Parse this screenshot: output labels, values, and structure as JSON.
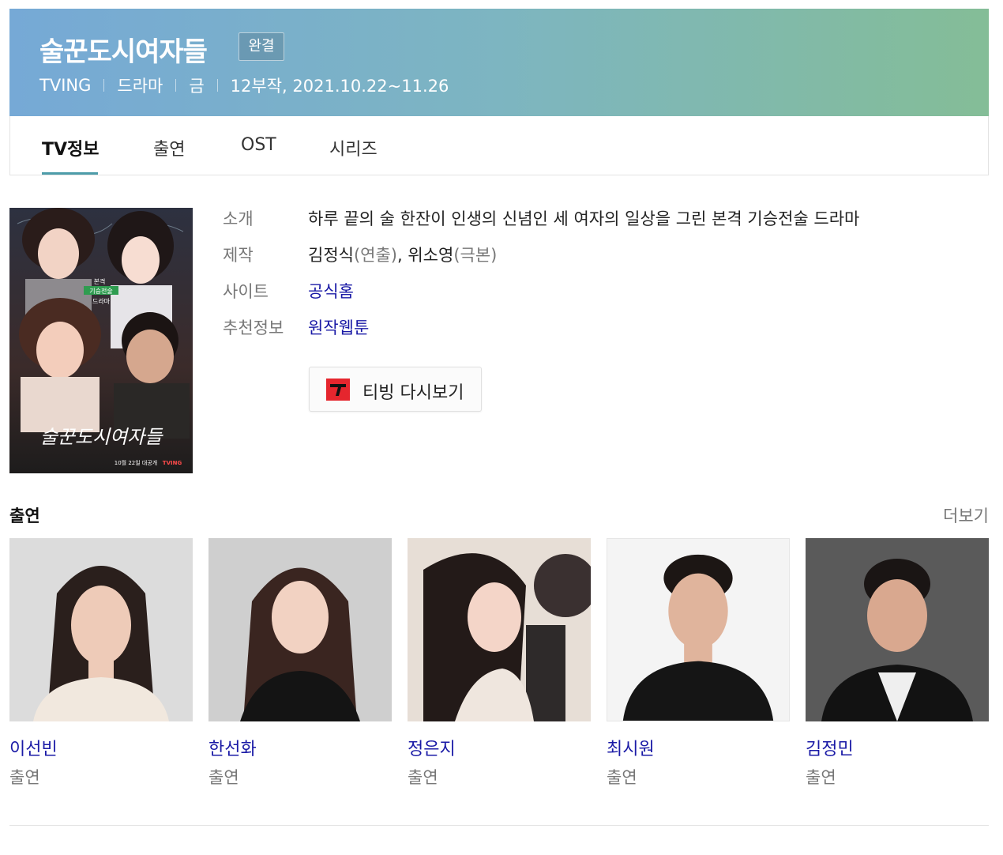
{
  "header": {
    "title": "술꾼도시여자들",
    "badge": "완결",
    "meta": [
      "TVING",
      "드라마",
      "금",
      "12부작, 2021.10.22~11.26"
    ]
  },
  "tabs": [
    {
      "label": "TV정보",
      "active": true
    },
    {
      "label": "출연",
      "active": false
    },
    {
      "label": "OST",
      "active": false
    },
    {
      "label": "시리즈",
      "active": false
    }
  ],
  "poster": {
    "title": "술꾼도시여자들",
    "tagline": [
      "본격",
      "기승전술",
      "드라마"
    ],
    "broadcast": "10월 22일 대공개",
    "brand": "TVING"
  },
  "info": {
    "intro_label": "소개",
    "intro_value": "하루 끝의 술 한잔이 인생의 신념인 세 여자의 일상을 그린 본격 기승전술 드라마",
    "production_label": "제작",
    "director": "김정식",
    "director_role": "(연출)",
    "comma": ", ",
    "writer": "위소영",
    "writer_role": "(극본)",
    "site_label": "사이트",
    "site_value": "공식홈",
    "recommend_label": "추천정보",
    "recommend_value": "원작웹툰"
  },
  "watch_button": {
    "label": "티빙 다시보기",
    "icon": "tving-icon",
    "icon_color": "#e5262e"
  },
  "cast_section": {
    "heading": "출연",
    "more": "더보기",
    "members": [
      {
        "name": "이선빈",
        "role": "출연"
      },
      {
        "name": "한선화",
        "role": "출연"
      },
      {
        "name": "정은지",
        "role": "출연"
      },
      {
        "name": "최시원",
        "role": "출연"
      },
      {
        "name": "김정민",
        "role": "출연"
      }
    ]
  },
  "colors": {
    "link": "#1a1aa6",
    "accent_underline": "#4d9ca9",
    "header_gradient": [
      "#76a9d6",
      "#84bd97"
    ]
  }
}
